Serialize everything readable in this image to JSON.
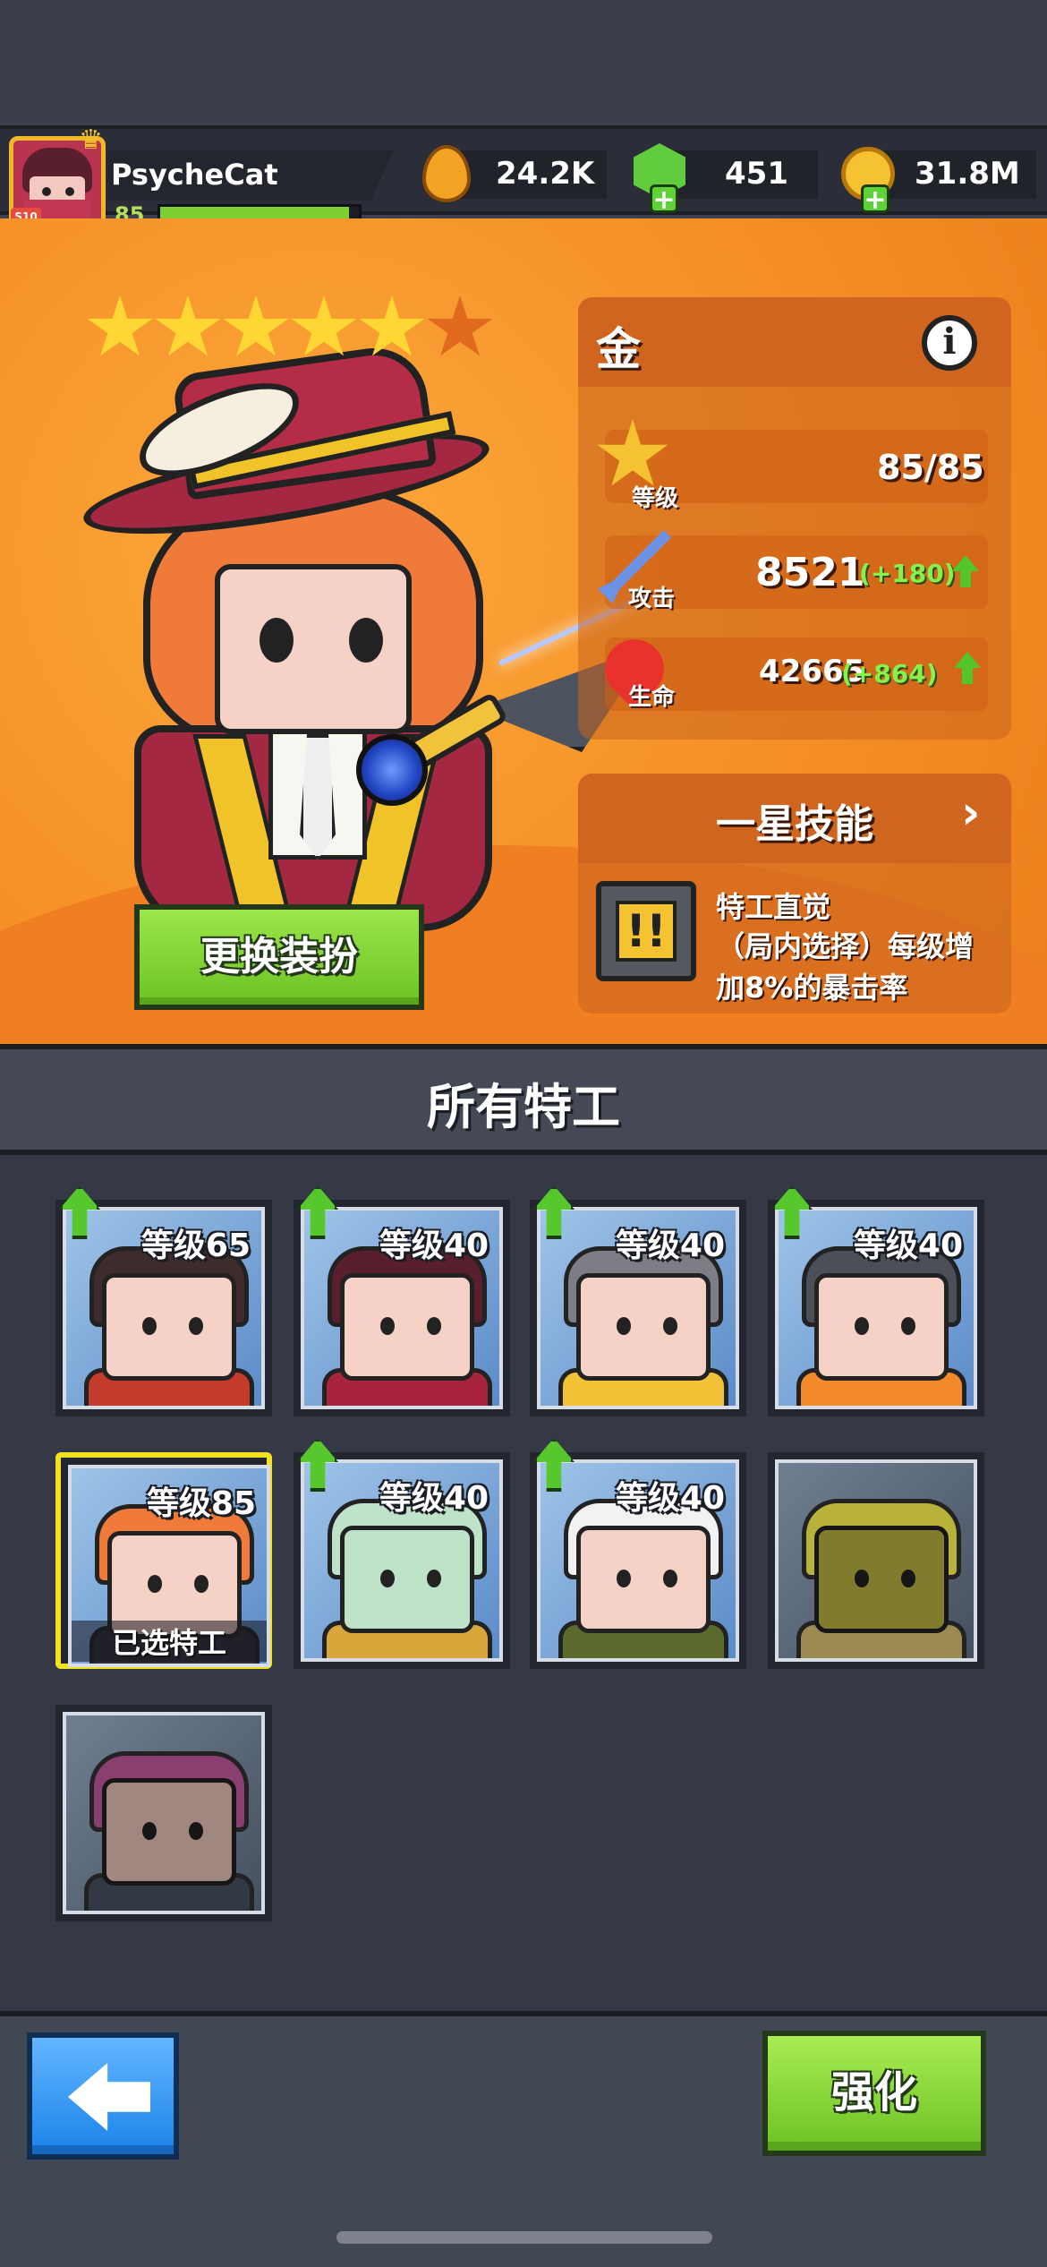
{
  "player": {
    "name": "PsycheCat",
    "level": "85",
    "badge": "S10",
    "xp_fraction": 0.95
  },
  "currencies": {
    "energy": "24.2K",
    "gems": "451",
    "gold": "31.8M"
  },
  "hero": {
    "stars_filled": 5,
    "stars_total": 6,
    "rarity": "金",
    "outfit_button": "更换装扮",
    "stats": {
      "level_label": "等级",
      "level_value": "85/85",
      "attack_label": "攻击",
      "attack_value": "8521",
      "attack_bonus": "(+180)",
      "hp_label": "生命",
      "hp_value": "42665",
      "hp_bonus": "(+864)"
    },
    "skill": {
      "title": "一星技能",
      "chevron": "›",
      "icon_glyph": "!!",
      "name": "特工直觉",
      "description": "（局内选择）每级增加8%的暴击率"
    }
  },
  "agents_section": {
    "title": "所有特工",
    "agents": [
      {
        "level": "等级65",
        "upgradable": true,
        "locked": false,
        "selected": false,
        "icon": "goggles-agent-icon"
      },
      {
        "level": "等级40",
        "upgradable": true,
        "locked": false,
        "selected": false,
        "icon": "ninja-agent-icon"
      },
      {
        "level": "等级40",
        "upgradable": true,
        "locked": false,
        "selected": false,
        "icon": "cat-agent-icon"
      },
      {
        "level": "等级40",
        "upgradable": true,
        "locked": false,
        "selected": false,
        "icon": "robot-agent-icon"
      },
      {
        "level": "等级85",
        "upgradable": false,
        "locked": false,
        "selected": true,
        "selected_label": "已选特工",
        "icon": "musketeer-agent-icon"
      },
      {
        "level": "等级40",
        "upgradable": true,
        "locked": false,
        "selected": false,
        "icon": "squid-agent-icon"
      },
      {
        "level": "等级40",
        "upgradable": true,
        "locked": false,
        "selected": false,
        "icon": "soldier-agent-icon"
      },
      {
        "level": "",
        "upgradable": false,
        "locked": true,
        "selected": false,
        "icon": "sponge-agent-icon"
      },
      {
        "level": "",
        "upgradable": false,
        "locked": true,
        "selected": false,
        "icon": "punk-agent-icon"
      }
    ]
  },
  "bottom": {
    "upgrade_button": "强化"
  },
  "colors": {
    "accent_green": "#6cc224",
    "accent_orange": "#f59026",
    "back_blue": "#1a83e8",
    "selected_yellow": "#f0e220"
  }
}
